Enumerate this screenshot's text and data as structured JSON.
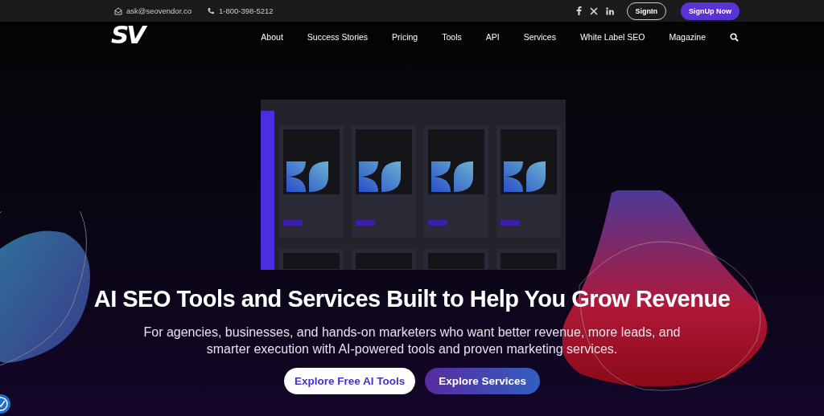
{
  "topbar": {
    "email": "ask@seovendor.co",
    "phone": "1-800-398-5212",
    "signin": "SignIn",
    "signup": "SignUp Now"
  },
  "nav": {
    "logo": "SV",
    "items": [
      "About",
      "Success Stories",
      "Pricing",
      "Tools",
      "API",
      "Services",
      "White Label SEO",
      "Magazine"
    ]
  },
  "hero": {
    "headline": "AI SEO Tools and Services Built to Help You Grow Revenue",
    "text": "For agencies, businesses, and hands-on marketers who want better revenue, more leads, and smarter execution with AI-powered tools and proven marketing services.",
    "buttons": [
      {
        "label": "Explore Free AI Tools",
        "kind": "light"
      },
      {
        "label": "Explore Services",
        "kind": "gradient"
      }
    ]
  }
}
